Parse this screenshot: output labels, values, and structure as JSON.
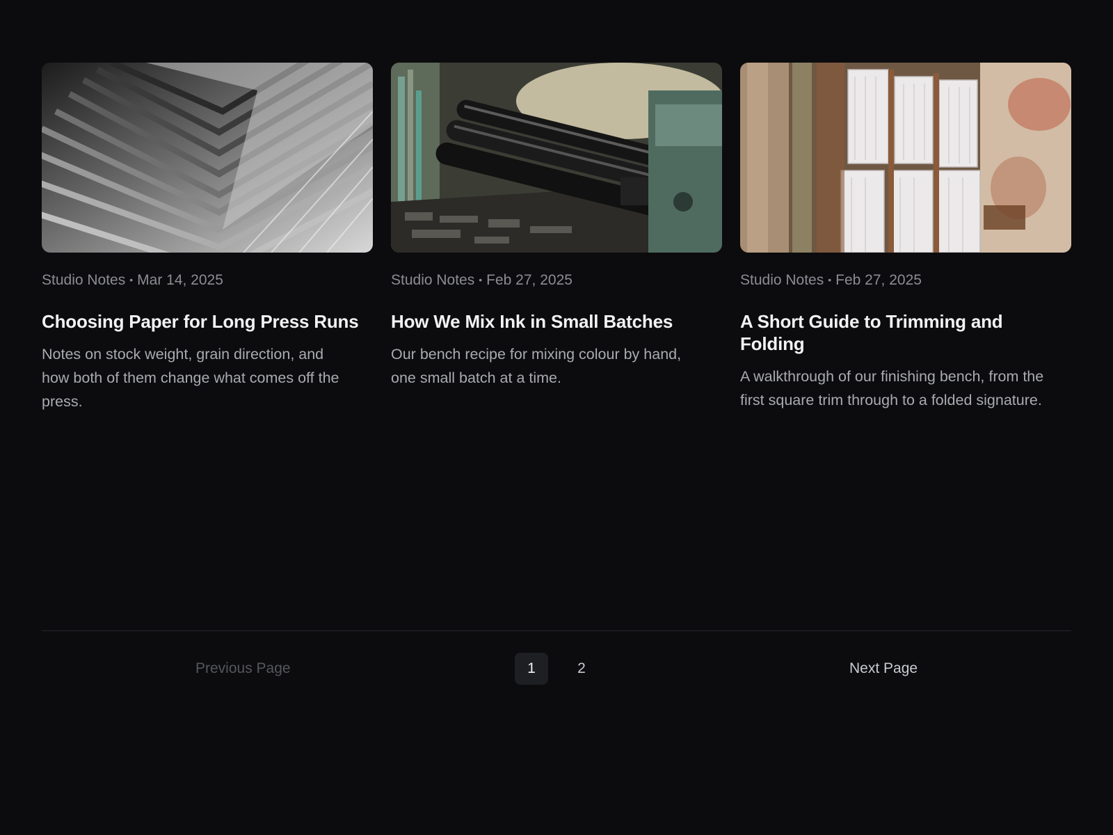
{
  "posts": [
    {
      "image": "stacked-paper-sheets",
      "category": "Studio Notes",
      "date": "Mar 14, 2025",
      "title": "Choosing Paper for Long Press Runs",
      "excerpt": "Notes on stock weight, grain direction, and how both of them change what comes off the press."
    },
    {
      "image": "letterpress-machine-rollers",
      "category": "Studio Notes",
      "date": "Feb 27, 2025",
      "title": "How We Mix Ink in Small Batches",
      "excerpt": "Our bench recipe for mixing colour by hand, one small batch at a time."
    },
    {
      "image": "bound-book-signatures",
      "category": "Studio Notes",
      "date": "Feb 27, 2025",
      "title": "A Short Guide to Trimming and Folding",
      "excerpt": "A walkthrough of our finishing bench, from the first square trim through to a folded signature."
    }
  ],
  "meta_separator": "•",
  "pagination": {
    "previous_label": "Previous Page",
    "next_label": "Next Page",
    "pages": [
      "1",
      "2"
    ],
    "current_page": "1"
  },
  "colors": {
    "background": "#0c0c0e",
    "title": "#f2f2f4",
    "meta": "#8b8d92",
    "excerpt": "#a9abb0",
    "active_page_bg": "#1e1f22"
  }
}
